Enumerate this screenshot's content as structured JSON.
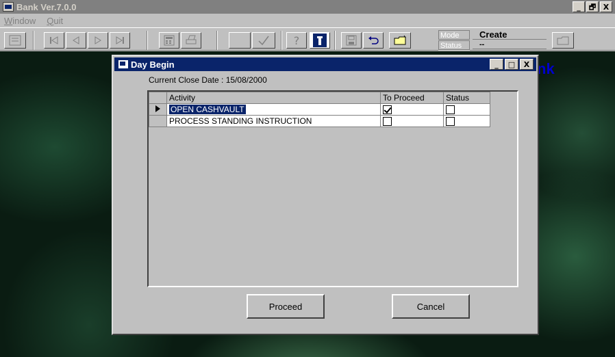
{
  "app": {
    "title": "Bank Ver.7.0.0",
    "window_buttons": [
      "_",
      "🗗",
      "X"
    ]
  },
  "menu": {
    "items": [
      "Window",
      "Quit"
    ]
  },
  "toolbar": {
    "buttons": [
      {
        "name": "exit-icon"
      },
      {
        "name": "first-record-icon"
      },
      {
        "name": "previous-record-icon"
      },
      {
        "name": "next-record-icon"
      },
      {
        "name": "last-record-icon"
      },
      {
        "name": "calculator-icon"
      },
      {
        "name": "print-icon"
      },
      {
        "name": "blank-button"
      },
      {
        "name": "check-icon"
      },
      {
        "name": "help-icon"
      },
      {
        "name": "info-icon"
      },
      {
        "name": "save-icon"
      },
      {
        "name": "undo-icon"
      },
      {
        "name": "open-folder-icon"
      },
      {
        "name": "folder-icon"
      }
    ],
    "mode_label": "Mode",
    "mode_value": "Create",
    "status_label": "Status",
    "status_value": "--"
  },
  "background": {
    "partial_text": "nk"
  },
  "dialog": {
    "title": "Day Begin",
    "window_buttons": [
      "_",
      "□",
      "X"
    ],
    "close_date_label": "Current Close Date : 15/08/2000",
    "grid": {
      "columns": [
        "Activity",
        "To Proceed",
        "Status"
      ],
      "rows": [
        {
          "activity": "OPEN CASHVAULT",
          "to_proceed": true,
          "status": false,
          "current": true,
          "selected": true
        },
        {
          "activity": "PROCESS STANDING INSTRUCTION",
          "to_proceed": false,
          "status": false,
          "current": false,
          "selected": false
        }
      ]
    },
    "proceed_label": "Proceed",
    "cancel_label": "Cancel"
  }
}
